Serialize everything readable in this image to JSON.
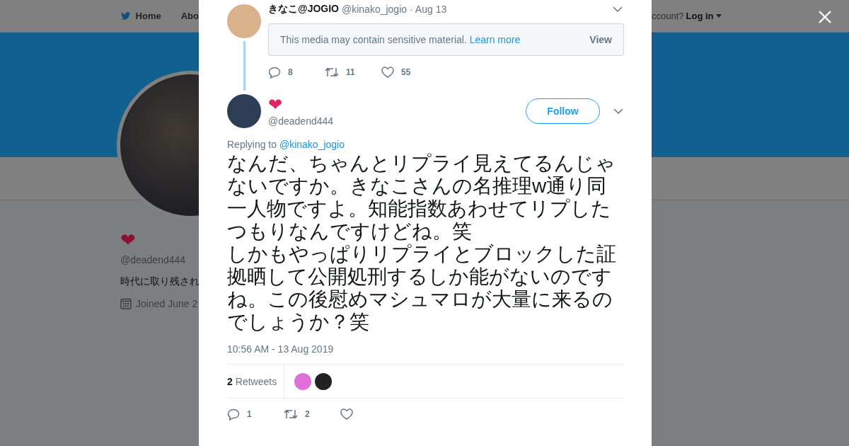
{
  "background_page": {
    "nav": {
      "items": [
        {
          "label": "Home"
        },
        {
          "label": "Abo"
        }
      ],
      "account_prompt": "ccount?",
      "login": "Log in"
    },
    "profile": {
      "display_name": "❤",
      "handle": "@deadend444",
      "bio": "時代に取り残され",
      "joined": "Joined June 2"
    }
  },
  "parent_tweet": {
    "name": "きなこ@JOGIO",
    "handle": "@kinako_jogio",
    "date": "· Aug 13",
    "notice": "This media may contain sensitive material.",
    "notice_link": "Learn more",
    "view": "View",
    "replies": "8",
    "retweets": "11",
    "likes": "55"
  },
  "tweet": {
    "name": "❤",
    "handle": "@deadend444",
    "follow": "Follow",
    "replying_label": "Replying to",
    "replying_to": "@kinako_jogio",
    "paragraphs": [
      "なんだ、ちゃんとリプライ見えてるんじゃないですか。きなこさんの名推理w通り同一人物ですよ。知能指数あわせてリプしたつもりなんですけどね。笑",
      "しかもやっぱりリプライとブロックした証拠晒して公開処刑するしか能がないのですね。この後慰めマシュマロが大量に来るのでしょうか？笑"
    ],
    "time": "10:56 AM - 13 Aug 2019",
    "retweet_count": "2",
    "retweet_label": "Retweets",
    "retweeters": [
      {
        "color": "#e070d8"
      },
      {
        "color": "#222222"
      }
    ],
    "replies": "1",
    "retweets": "2"
  }
}
